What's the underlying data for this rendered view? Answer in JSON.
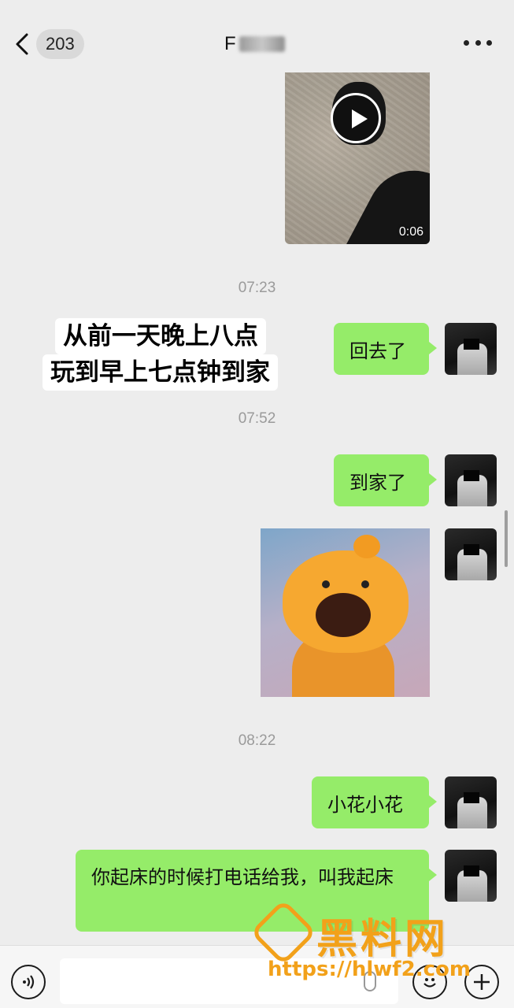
{
  "header": {
    "back_count": "203",
    "title_initial": "F",
    "icons": {
      "back": "chevron-left-icon",
      "more": "more-dots-icon"
    }
  },
  "video_message": {
    "duration": "0:06",
    "icon": "play-icon"
  },
  "timestamps": [
    "07:23",
    "07:52",
    "08:22"
  ],
  "caption_overlay": {
    "line1": "从前一天晚上八点",
    "line2": "玩到早上七点钟到家"
  },
  "messages": [
    {
      "text": "回去了",
      "side": "right"
    },
    {
      "text": "到家了",
      "side": "right"
    },
    {
      "text": "小花小花",
      "side": "right"
    },
    {
      "text": "你起床的时候打电话给我，叫我起床",
      "side": "right"
    }
  ],
  "bottom_bar": {
    "icons": [
      "voice-icon",
      "microphone-icon",
      "emoji-icon",
      "plus-icon"
    ]
  },
  "watermark": {
    "title": "黑料网",
    "url": "https://hlwf2.com"
  },
  "colors": {
    "background": "#ededed",
    "bubble_green": "#95ec69",
    "watermark": "#f2a11a"
  }
}
